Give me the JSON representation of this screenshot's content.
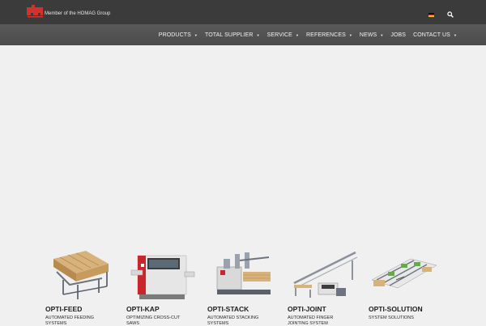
{
  "header": {
    "tagline": "Member of the HOMAG Group",
    "language_flag": "de-flag-icon",
    "search_icon": "search-icon"
  },
  "nav": {
    "items": [
      {
        "label": "PRODUCTS",
        "has_dropdown": true
      },
      {
        "label": "TOTAL SUPPLIER",
        "has_dropdown": true
      },
      {
        "label": "SERVICE",
        "has_dropdown": true
      },
      {
        "label": "REFERENCES",
        "has_dropdown": true
      },
      {
        "label": "NEWS",
        "has_dropdown": true
      },
      {
        "label": "JOBS",
        "has_dropdown": false
      },
      {
        "label": "CONTACT US",
        "has_dropdown": true
      }
    ]
  },
  "products": [
    {
      "name": "OPTI-FEED",
      "desc": "AUTOMATED FEEDING SYSTEMS"
    },
    {
      "name": "OPTI-KAP",
      "desc": "OPTIMIZING CROSS-CUT SAWS"
    },
    {
      "name": "OPTI-STACK",
      "desc": "AUTOMATED STACKING SYSTEMS"
    },
    {
      "name": "OPTI-JOINT",
      "desc": "AUTOMATED FINGER JOINTING SYSTEM"
    },
    {
      "name": "OPTI-SOLUTION",
      "desc": "SYSTEM SOLUTIONS"
    }
  ],
  "colors": {
    "topbar": "#3b3b3b",
    "navbar": "#555555",
    "brand_red": "#d0322d",
    "page_bg": "#f0f0f0"
  }
}
